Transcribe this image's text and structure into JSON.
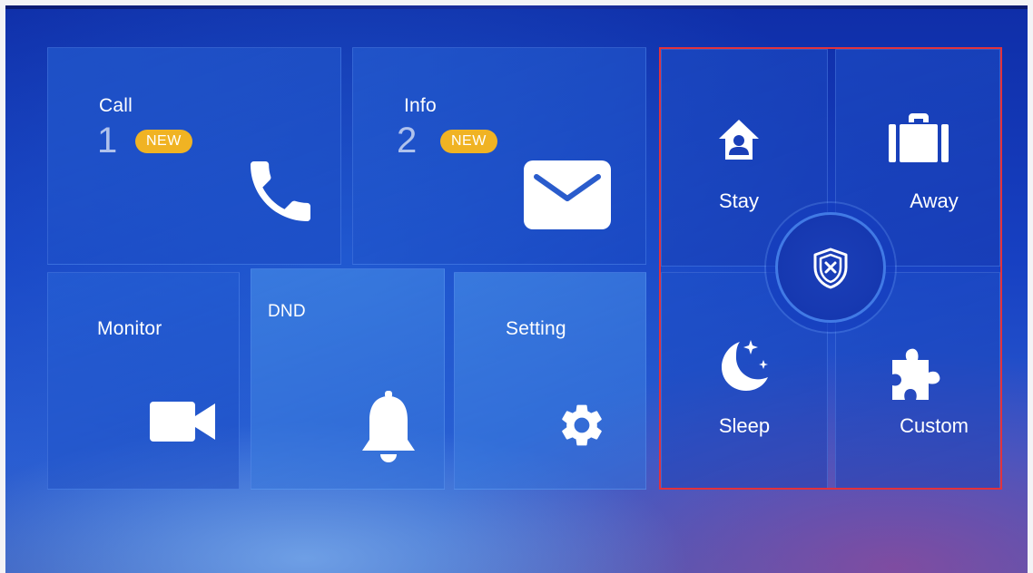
{
  "tiles": {
    "call": {
      "label": "Call",
      "count": "1",
      "badge": "NEW",
      "icon": "phone-icon"
    },
    "info": {
      "label": "Info",
      "count": "2",
      "badge": "NEW",
      "icon": "envelope-icon"
    },
    "monitor": {
      "label": "Monitor",
      "icon": "video-camera-icon"
    },
    "dnd": {
      "label": "DND",
      "icon": "bell-icon"
    },
    "setting": {
      "label": "Setting",
      "icon": "gear-icon"
    }
  },
  "arm_modes": {
    "stay": {
      "label": "Stay",
      "icon": "home-person-icon"
    },
    "away": {
      "label": "Away",
      "icon": "briefcase-icon"
    },
    "sleep": {
      "label": "Sleep",
      "icon": "moon-stars-icon"
    },
    "custom": {
      "label": "Custom",
      "icon": "puzzle-icon"
    },
    "disarm": {
      "icon": "shield-x-icon"
    }
  },
  "colors": {
    "badge": "#f0b323",
    "arm_panel_border": "#e2323c",
    "background": "#1740c2"
  }
}
